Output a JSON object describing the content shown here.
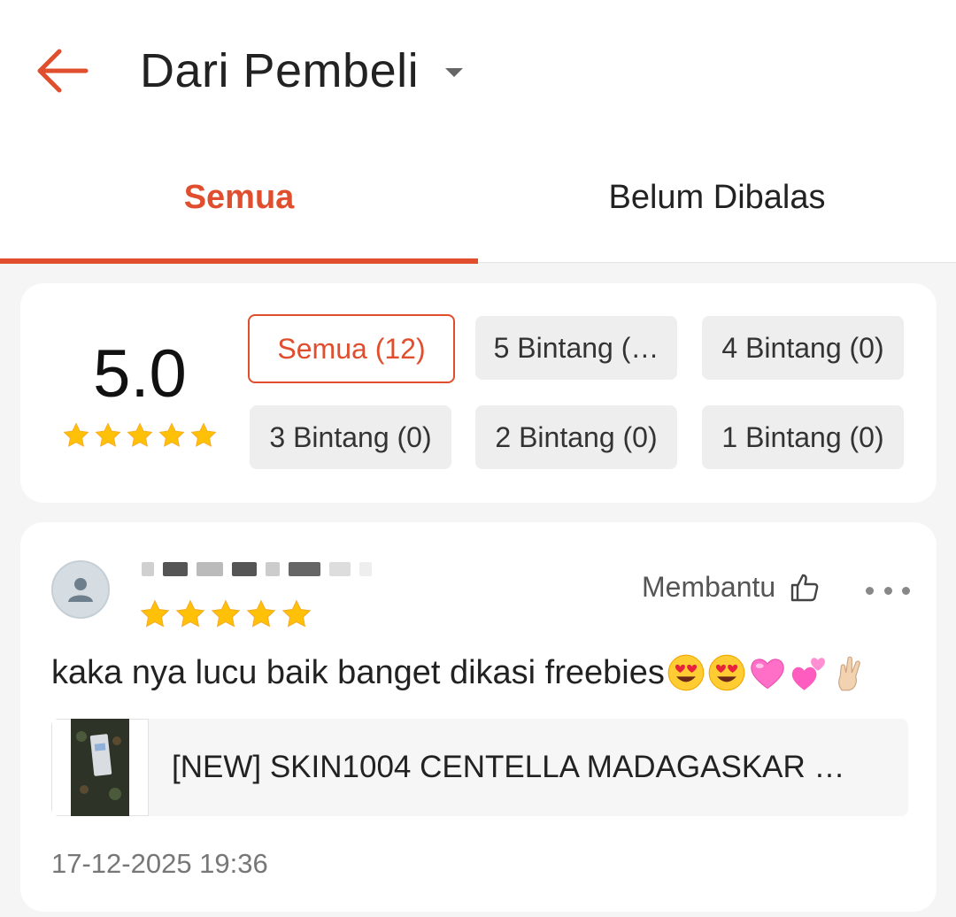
{
  "header": {
    "title": "Dari Pembeli",
    "back_icon": "arrow-left-icon",
    "dropdown_icon": "caret-down-icon",
    "accent_color": "#e04e2e"
  },
  "tabs": [
    {
      "label": "Semua",
      "active": true
    },
    {
      "label": "Belum Dibalas",
      "active": false
    }
  ],
  "rating_summary": {
    "score": "5.0",
    "stars": 5,
    "filters": [
      {
        "label": "Semua (12)",
        "active": true
      },
      {
        "label": "5 Bintang (…",
        "active": false
      },
      {
        "label": "4 Bintang (0)",
        "active": false
      },
      {
        "label": "3 Bintang (0)",
        "active": false
      },
      {
        "label": "2 Bintang (0)",
        "active": false
      },
      {
        "label": "1 Bintang (0)",
        "active": false
      }
    ]
  },
  "review": {
    "username": "",
    "rating": 5,
    "helpful_label": "Membantu",
    "helpful_icon": "thumbs-up-icon",
    "more_icon": "more-horizontal-icon",
    "text": "kaka nya lucu baik banget dikasi freebies",
    "emojis": [
      "heart-eyes-emoji",
      "heart-eyes-emoji",
      "pink-heart-emoji",
      "two-hearts-emoji",
      "crossed-fingers-emoji"
    ],
    "product_name": "[NEW] SKIN1004 CENTELLA MADAGASKAR …",
    "timestamp": "17-12-2025 19:36"
  }
}
